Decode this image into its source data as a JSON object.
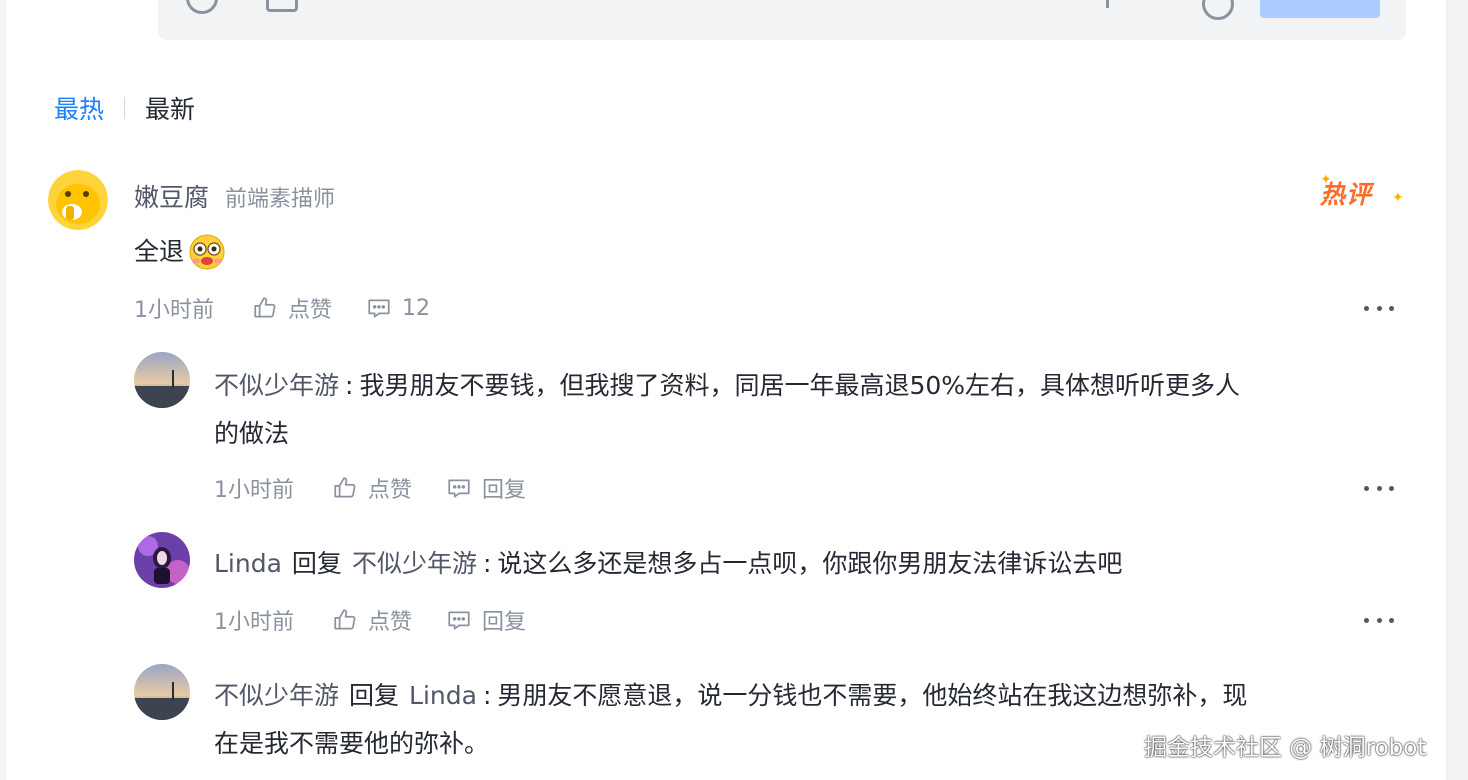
{
  "sort_tabs": {
    "hot": "最热",
    "newest": "最新"
  },
  "comment": {
    "author": "嫩豆腐",
    "author_title": "前端素描师",
    "badge": "热评",
    "text": "全退",
    "time": "1小时前",
    "like_label": "点赞",
    "reply_count": "12"
  },
  "replies": [
    {
      "author": "不似少年游",
      "text_line1": "我男朋友不要钱，但我搜了资料，同居一年最高退50%左右，具体想听听更多人",
      "text_line2": "的做法",
      "time": "1小时前",
      "like_label": "点赞",
      "reply_label": "回复"
    },
    {
      "author": "Linda",
      "reply_word": "回复",
      "reply_to": "不似少年游",
      "text": "说这么多还是想多占一点呗，你跟你男朋友法律诉讼去吧",
      "time": "1小时前",
      "like_label": "点赞",
      "reply_label": "回复"
    },
    {
      "author": "不似少年游",
      "reply_word": "回复",
      "reply_to": "Linda",
      "text_line1": "男朋友不愿意退，说一分钱也不需要，他始终站在我这边想弥补，现",
      "text_line2": "在是我不需要他的弥补。"
    }
  ],
  "watermark": "掘金技术社区 @ 树洞robot",
  "colors": {
    "accent": "#1e80ff",
    "hot_badge": "#ff6a2a",
    "text_primary": "#252933",
    "text_secondary": "#8a919f"
  }
}
